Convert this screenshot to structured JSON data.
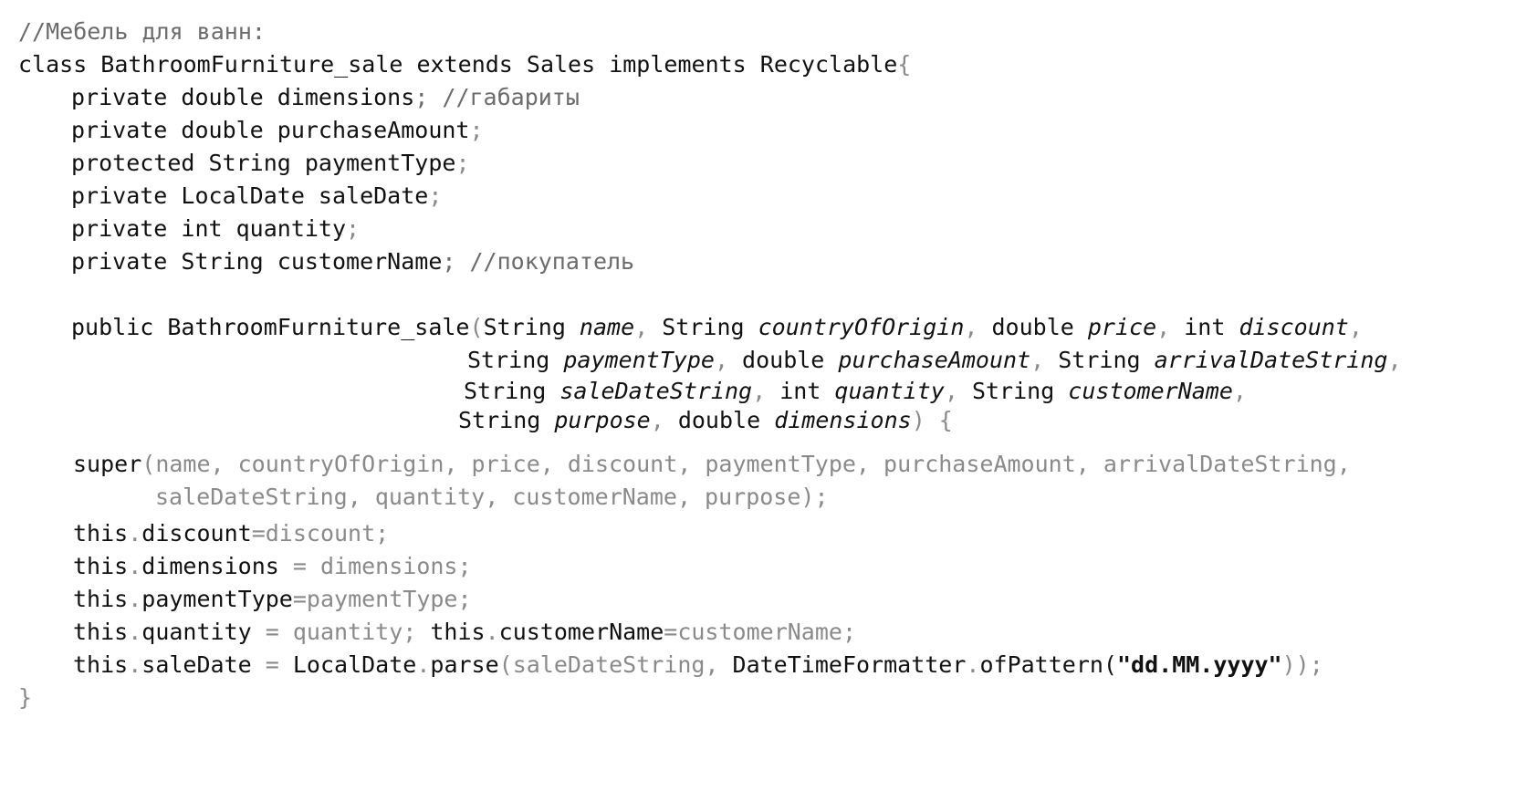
{
  "code": {
    "lines": [
      {
        "id": "l1",
        "tokens": [
          {
            "t": "//Мебель для ванн:",
            "c": "cm"
          }
        ]
      },
      {
        "id": "l2",
        "tokens": [
          {
            "t": "class BathroomFurniture_sale extends Sales implements Recyclable",
            "c": "kw"
          },
          {
            "t": "{",
            "c": "gr"
          }
        ]
      },
      {
        "id": "l3",
        "tokens": [
          {
            "t": "private double dimensions",
            "c": "kw"
          },
          {
            "t": "; //габариты",
            "c": "cm"
          }
        ]
      },
      {
        "id": "l4",
        "tokens": [
          {
            "t": "private double purchaseAmount",
            "c": "kw"
          },
          {
            "t": ";",
            "c": "gr"
          }
        ]
      },
      {
        "id": "l5",
        "tokens": [
          {
            "t": "protected String paymentType",
            "c": "kw"
          },
          {
            "t": ";",
            "c": "gr"
          }
        ]
      },
      {
        "id": "l6",
        "tokens": [
          {
            "t": "private LocalDate saleDate",
            "c": "kw"
          },
          {
            "t": ";",
            "c": "gr"
          }
        ]
      },
      {
        "id": "l7",
        "tokens": [
          {
            "t": "private int quantity",
            "c": "kw"
          },
          {
            "t": ";",
            "c": "gr"
          }
        ]
      },
      {
        "id": "l8",
        "tokens": [
          {
            "t": "private String customerName",
            "c": "kw"
          },
          {
            "t": "; //покупатель",
            "c": "cm"
          }
        ]
      },
      {
        "id": "l9",
        "tokens": [
          {
            "t": "public BathroomFurniture_sale",
            "c": "kw"
          },
          {
            "t": "(",
            "c": "gr"
          },
          {
            "t": "String ",
            "c": "kw"
          },
          {
            "t": "name",
            "c": "kw it"
          },
          {
            "t": ", ",
            "c": "gr"
          },
          {
            "t": "String ",
            "c": "kw"
          },
          {
            "t": "countryOfOrigin",
            "c": "kw it"
          },
          {
            "t": ", ",
            "c": "gr"
          },
          {
            "t": "double ",
            "c": "kw"
          },
          {
            "t": "price",
            "c": "kw it"
          },
          {
            "t": ", ",
            "c": "gr"
          },
          {
            "t": "int ",
            "c": "kw"
          },
          {
            "t": "discount",
            "c": "kw it"
          },
          {
            "t": ",",
            "c": "gr"
          }
        ]
      },
      {
        "id": "l10",
        "tokens": [
          {
            "t": "String ",
            "c": "kw"
          },
          {
            "t": "paymentType",
            "c": "kw it"
          },
          {
            "t": ", ",
            "c": "gr"
          },
          {
            "t": "double ",
            "c": "kw"
          },
          {
            "t": "purchaseAmount",
            "c": "kw it"
          },
          {
            "t": ", ",
            "c": "gr"
          },
          {
            "t": "String ",
            "c": "kw"
          },
          {
            "t": "arrivalDateString",
            "c": "kw it"
          },
          {
            "t": ",",
            "c": "gr"
          }
        ]
      },
      {
        "id": "l11",
        "tokens": [
          {
            "t": "String ",
            "c": "kw"
          },
          {
            "t": "saleDateString",
            "c": "kw it"
          },
          {
            "t": ", ",
            "c": "gr"
          },
          {
            "t": "int ",
            "c": "kw"
          },
          {
            "t": "quantity",
            "c": "kw it"
          },
          {
            "t": ", ",
            "c": "gr"
          },
          {
            "t": "String ",
            "c": "kw"
          },
          {
            "t": "customerName",
            "c": "kw it"
          },
          {
            "t": ",",
            "c": "gr"
          }
        ]
      },
      {
        "id": "l12",
        "tokens": [
          {
            "t": "String ",
            "c": "kw"
          },
          {
            "t": "purpose",
            "c": "kw it"
          },
          {
            "t": ", ",
            "c": "gr"
          },
          {
            "t": "double ",
            "c": "kw"
          },
          {
            "t": "dimensions",
            "c": "kw it"
          },
          {
            "t": ") {",
            "c": "gr"
          }
        ]
      },
      {
        "id": "l13",
        "tokens": [
          {
            "t": "super",
            "c": "kw"
          },
          {
            "t": "(name, countryOfOrigin, price, discount, paymentType, purchaseAmount, arrivalDateString,",
            "c": "gr"
          }
        ]
      },
      {
        "id": "l14",
        "tokens": [
          {
            "t": "saleDateString, quantity, customerName, purpose);",
            "c": "gr"
          }
        ]
      },
      {
        "id": "l15",
        "tokens": [
          {
            "t": "this",
            "c": "kw"
          },
          {
            "t": ".",
            "c": "gr"
          },
          {
            "t": "discount",
            "c": "kw"
          },
          {
            "t": "=discount;",
            "c": "gr"
          }
        ]
      },
      {
        "id": "l16",
        "tokens": [
          {
            "t": "this",
            "c": "kw"
          },
          {
            "t": ".",
            "c": "gr"
          },
          {
            "t": "dimensions ",
            "c": "kw"
          },
          {
            "t": "= dimensions;",
            "c": "gr"
          }
        ]
      },
      {
        "id": "l17",
        "tokens": [
          {
            "t": "this",
            "c": "kw"
          },
          {
            "t": ".",
            "c": "gr"
          },
          {
            "t": "paymentType",
            "c": "kw"
          },
          {
            "t": "=paymentType;",
            "c": "gr"
          }
        ]
      },
      {
        "id": "l18",
        "tokens": [
          {
            "t": "this",
            "c": "kw"
          },
          {
            "t": ".",
            "c": "gr"
          },
          {
            "t": "quantity ",
            "c": "kw"
          },
          {
            "t": "= quantity; ",
            "c": "gr"
          },
          {
            "t": "this",
            "c": "kw"
          },
          {
            "t": ".",
            "c": "gr"
          },
          {
            "t": "customerName",
            "c": "kw"
          },
          {
            "t": "=customerName;",
            "c": "gr"
          }
        ]
      },
      {
        "id": "l19",
        "tokens": [
          {
            "t": "this",
            "c": "kw"
          },
          {
            "t": ".",
            "c": "gr"
          },
          {
            "t": "saleDate ",
            "c": "kw"
          },
          {
            "t": "= ",
            "c": "gr"
          },
          {
            "t": "LocalDate",
            "c": "kw"
          },
          {
            "t": ".",
            "c": "gr"
          },
          {
            "t": "parse",
            "c": "kw"
          },
          {
            "t": "(saleDateString, ",
            "c": "gr"
          },
          {
            "t": "DateTimeFormatter",
            "c": "kw"
          },
          {
            "t": ".",
            "c": "gr"
          },
          {
            "t": "ofPattern(",
            "c": "kw"
          },
          {
            "t": "\"dd.MM.yyyy\"",
            "c": "str"
          },
          {
            "t": "));",
            "c": "gr"
          }
        ]
      },
      {
        "id": "l20",
        "tokens": [
          {
            "t": "}",
            "c": "gr"
          }
        ]
      }
    ]
  }
}
